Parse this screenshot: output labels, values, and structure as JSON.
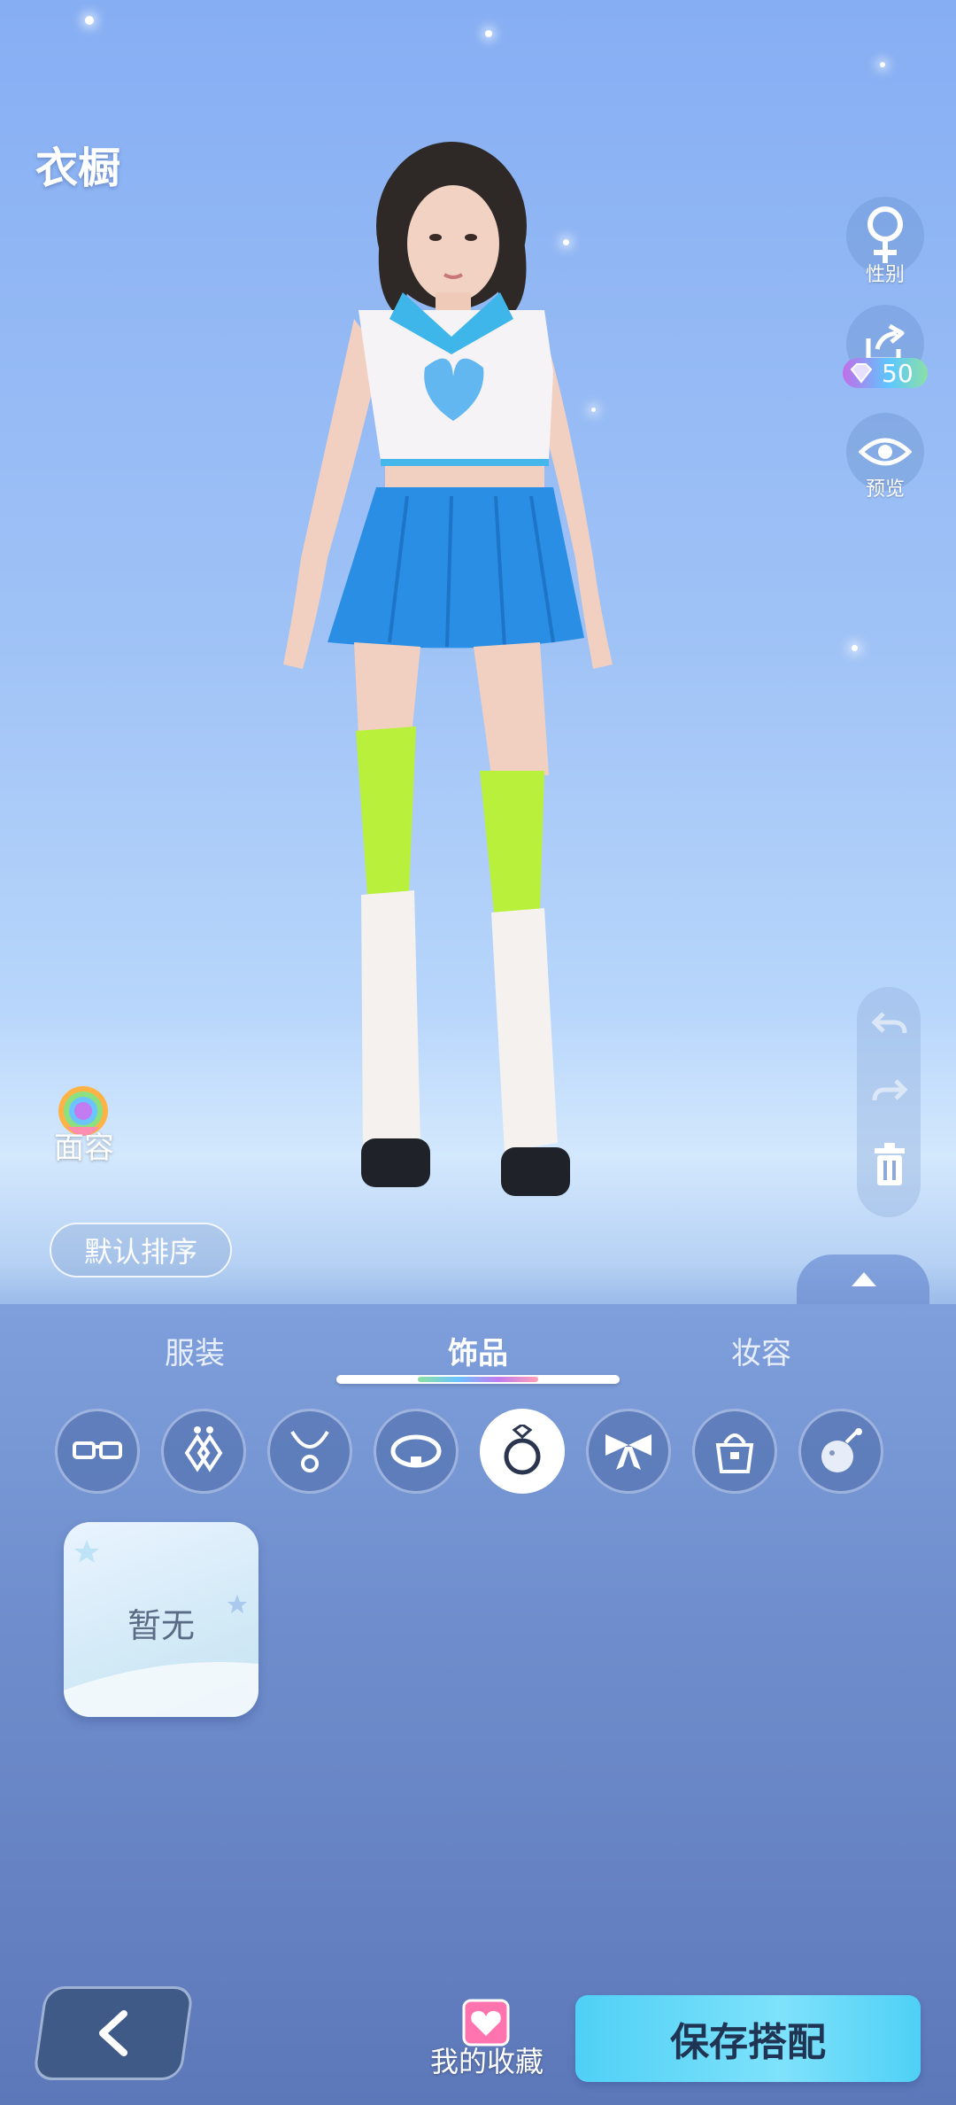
{
  "header": {
    "title": "衣橱"
  },
  "side_controls": {
    "gender_label": "性别",
    "share_cost": "50",
    "preview_label": "预览"
  },
  "face": {
    "label": "面容"
  },
  "sort": {
    "label": "默认排序"
  },
  "tabs": [
    {
      "label": "服装",
      "active": false
    },
    {
      "label": "饰品",
      "active": true
    },
    {
      "label": "妆容",
      "active": false
    }
  ],
  "categories": [
    {
      "icon": "glasses-icon",
      "active": false
    },
    {
      "icon": "earrings-icon",
      "active": false
    },
    {
      "icon": "necklace-icon",
      "active": false
    },
    {
      "icon": "bracelet-icon",
      "active": false
    },
    {
      "icon": "ring-icon",
      "active": true
    },
    {
      "icon": "bow-icon",
      "active": false
    },
    {
      "icon": "handbag-icon",
      "active": false
    },
    {
      "icon": "misc-accessory-icon",
      "active": false
    }
  ],
  "empty_state": {
    "label": "暂无"
  },
  "bottom_bar": {
    "favorites_label": "我的收藏",
    "save_label": "保存搭配"
  },
  "colors": {
    "accent": "#4fd0f6",
    "panel": "#6f8dcc",
    "back_button": "#3f5a86"
  }
}
